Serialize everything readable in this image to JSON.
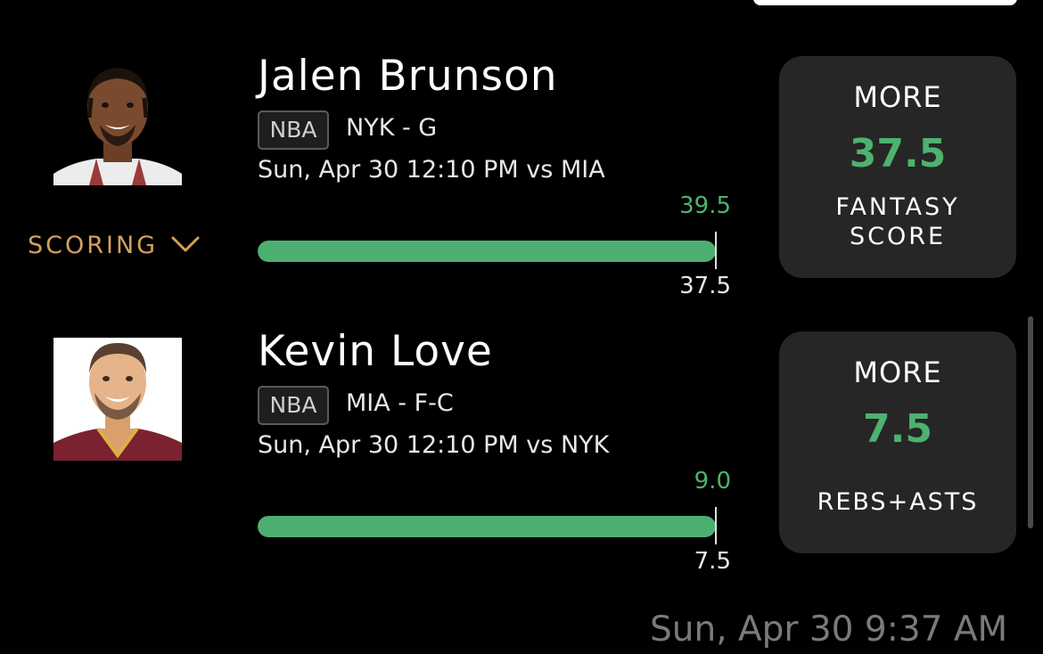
{
  "picks": [
    {
      "player_name": "Jalen Brunson",
      "league": "NBA",
      "team_position": "NYK - G",
      "game_time": "Sun, Apr 30 12:10 PM  vs MIA",
      "projection": "39.5",
      "line": "37.5",
      "progress_percent": 100,
      "scoring_label": "SCORING",
      "card": {
        "direction": "MORE",
        "line": "37.5",
        "stat": "FANTASY SCORE"
      }
    },
    {
      "player_name": "Kevin Love",
      "league": "NBA",
      "team_position": "MIA - F-C",
      "game_time": "Sun, Apr 30 12:10 PM  vs NYK",
      "projection": "9.0",
      "line": "7.5",
      "progress_percent": 100,
      "card": {
        "direction": "MORE",
        "line": "7.5",
        "stat": "REBS+ASTS"
      }
    }
  ],
  "timestamp": "Sun, Apr 30 9:37 AM",
  "colors": {
    "accent_green": "#4db26f",
    "scoring_gold": "#d4a05c",
    "card_bg": "#262626"
  },
  "icons": [
    "chevron-down-icon"
  ]
}
